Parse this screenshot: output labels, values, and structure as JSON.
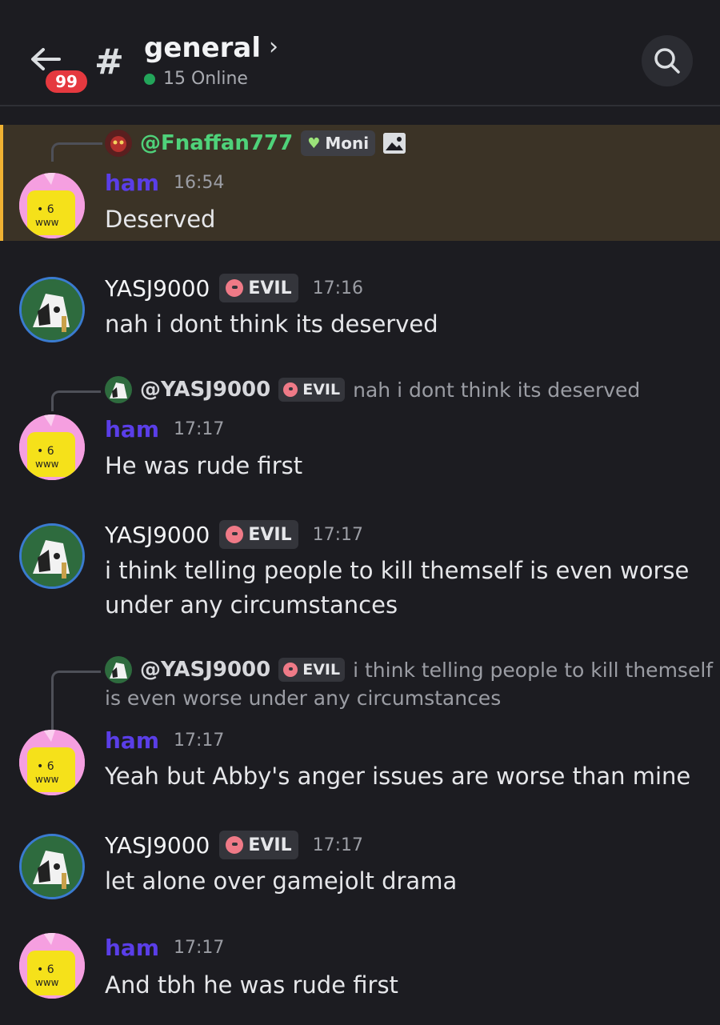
{
  "header": {
    "unread_count": "99",
    "channel_name": "general",
    "online_text": "15 Online"
  },
  "icons": {
    "back": "back-arrow-icon",
    "hash": "hash-icon",
    "chevron": "chevron-right-icon",
    "search": "search-icon",
    "skull": "skull-icon",
    "heart": "heart-icon",
    "image": "image-icon"
  },
  "colors": {
    "ham_name": "#5a3ee8",
    "online_dot": "#23a55a",
    "badge": "#e5393f",
    "highlight_bar": "#f0b232",
    "reply_green": "#4fd27a"
  },
  "messages": [
    {
      "reply": {
        "name": "@Fnaffan777",
        "tag": "Moni"
      },
      "author": "ham",
      "time": "16:54",
      "text": "Deserved"
    },
    {
      "author": "YASJ9000",
      "tag": "EVIL",
      "time": "17:16",
      "text": "nah i dont think its deserved"
    },
    {
      "reply": {
        "name": "@YASJ9000",
        "tag": "EVIL",
        "preview": "nah i dont think its deserved"
      },
      "author": "ham",
      "time": "17:17",
      "text": "He was rude first"
    },
    {
      "author": "YASJ9000",
      "tag": "EVIL",
      "time": "17:17",
      "text_line1": "i think telling people to kill themself is even worse",
      "text_line2": "under any circumstances"
    },
    {
      "reply": {
        "name": "@YASJ9000",
        "tag": "EVIL",
        "preview_line1": "i think telling people to kill themself",
        "preview_line2": "is even worse under any circumstances"
      },
      "author": "ham",
      "time": "17:17",
      "text": "Yeah but Abby's anger issues are worse than mine"
    },
    {
      "author": "YASJ9000",
      "tag": "EVIL",
      "time": "17:17",
      "text": "let alone over gamejolt drama"
    },
    {
      "author": "ham",
      "time": "17:17",
      "text": "And tbh he was rude first"
    }
  ]
}
